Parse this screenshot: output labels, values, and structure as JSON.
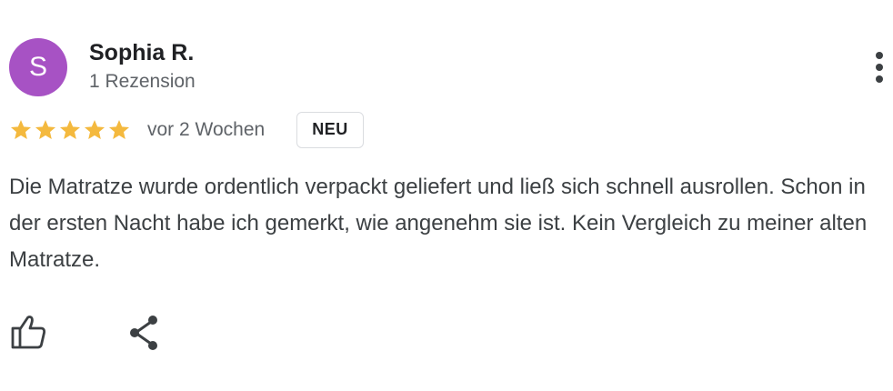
{
  "review": {
    "author": {
      "initial": "S",
      "name": "Sophia R.",
      "meta": "1 Rezension",
      "avatar_color": "#a752c4"
    },
    "rating": {
      "stars": 5,
      "max": 5,
      "star_color": "#f4b93e"
    },
    "time_ago": "vor 2 Wochen",
    "badge": "NEU",
    "text": "Die Matratze wurde ordentlich verpackt geliefert und ließ sich schnell ausrollen. Schon in der ersten Nacht habe ich gemerkt, wie angenehm sie ist. Kein Vergleich zu meiner alten Matratze.",
    "actions": {
      "like_icon": "thumbs-up-icon",
      "share_icon": "share-icon",
      "menu_icon": "more-vert-icon"
    }
  }
}
